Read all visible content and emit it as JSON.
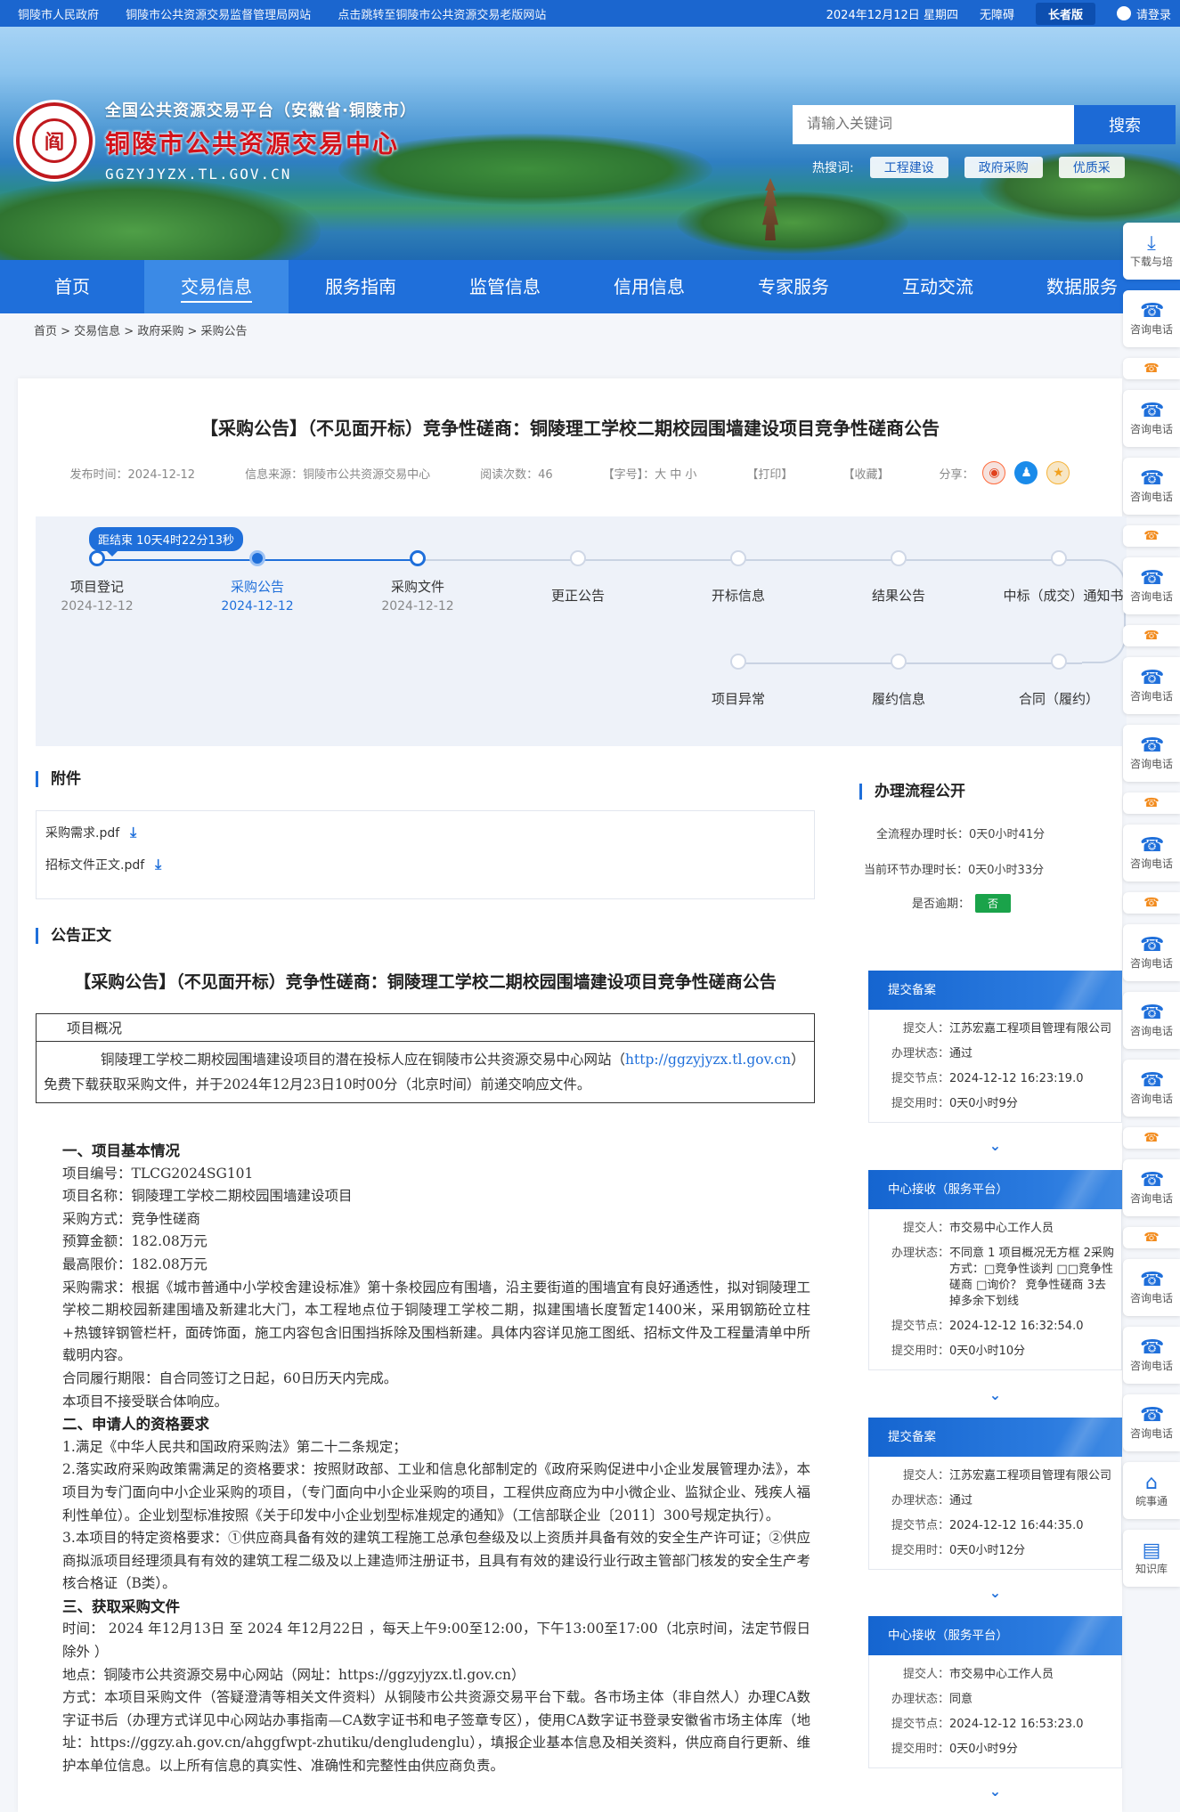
{
  "topbar": {
    "links": [
      "铜陵市人民政府",
      "铜陵市公共资源交易监督管理局网站",
      "点击跳转至铜陵市公共资源交易老版网站"
    ],
    "date": "2024年12月12日 星期四",
    "accessibility": "无障碍",
    "elder": "长者版",
    "login": "请登录"
  },
  "header": {
    "platform": "全国公共资源交易平台（安徽省·铜陵市）",
    "name": "铜陵市公共资源交易中心",
    "domain": "GGZYJYZX.TL.GOV.CN",
    "seal_char": "阎",
    "search_placeholder": "请输入关键词",
    "search_button": "搜索",
    "hot_label": "热搜词:",
    "hot_tags": [
      "工程建设",
      "政府采购",
      "优质采"
    ]
  },
  "nav": [
    "首页",
    "交易信息",
    "服务指南",
    "监管信息",
    "信用信息",
    "专家服务",
    "互动交流",
    "数据服务"
  ],
  "breadcrumb": "首页 > 交易信息 > 政府采购 > 采购公告",
  "side": {
    "first": "下载与培",
    "consult": "咨询电话",
    "wanshi": "皖事通",
    "knowledge": "知识库"
  },
  "article": {
    "title": "【采购公告】（不见面开标）竞争性磋商：铜陵理工学校二期校园围墙建设项目竞争性磋商公告",
    "publish": "发布时间：2024-12-12",
    "source": "信息来源：铜陵市公共资源交易中心",
    "reads": "阅读次数：46",
    "fontsize": "【字号】：大 中 小",
    "print": "【打印】",
    "fav": "【收藏】",
    "share": "分享："
  },
  "process": {
    "countdown": "距结束  10天4时22分13秒",
    "steps": [
      {
        "name": "项目登记",
        "date": "2024-12-12"
      },
      {
        "name": "采购公告",
        "date": "2024-12-12"
      },
      {
        "name": "采购文件",
        "date": "2024-12-12"
      },
      {
        "name": "更正公告",
        "date": ""
      },
      {
        "name": "开标信息",
        "date": ""
      },
      {
        "name": "结果公告",
        "date": ""
      },
      {
        "name": "中标（成交）通知书",
        "date": ""
      }
    ],
    "row2": [
      "项目异常",
      "履约信息",
      "合同（履约）"
    ]
  },
  "attachments": {
    "heading": "附件",
    "files": [
      "采购需求.pdf",
      "招标文件正文.pdf"
    ]
  },
  "notice": {
    "heading": "公告正文",
    "title": "【采购公告】（不见面开标）竞争性磋商：铜陵理工学校二期校园围墙建设项目竞争性磋商公告",
    "box_head": "项目概况",
    "box_text1": "铜陵理工学校二期校园围墙建设项目的潜在投标人应在铜陵市公共资源交易中心网站（",
    "box_link": "http://ggzyjyzx.tl.gov.cn",
    "box_text2": "）免费下载获取采购文件，并于2024年12月23日10时00分（北京时间）前递交响应文件。",
    "lines": [
      {
        "h": true,
        "t": "一、项目基本情况"
      },
      {
        "t": "项目编号：TLCG2024SG101"
      },
      {
        "t": "项目名称：铜陵理工学校二期校园围墙建设项目"
      },
      {
        "t": "采购方式：竞争性磋商"
      },
      {
        "t": "预算金额：182.08万元"
      },
      {
        "t": "最高限价：182.08万元"
      },
      {
        "j": true,
        "t": "采购需求：根据《城市普通中小学校舍建设标准》第十条校园应有围墙，沿主要街道的围墙宜有良好通透性，拟对铜陵理工学校二期校园新建围墙及新建北大门，本工程地点位于铜陵理工学校二期，拟建围墙长度暂定1400米，采用钢筋砼立柱+热镀锌钢管栏杆，面砖饰面，施工内容包含旧围挡拆除及围档新建。具体内容详见施工图纸、招标文件及工程量清单中所载明内容。"
      },
      {
        "t": "合同履行期限：自合同签订之日起，60日历天内完成。"
      },
      {
        "t": "本项目不接受联合体响应。"
      },
      {
        "h": true,
        "t": "二、申请人的资格要求"
      },
      {
        "t": "1.满足《中华人民共和国政府采购法》第二十二条规定；"
      },
      {
        "j": true,
        "t": "2.落实政府采购政策需满足的资格要求：按照财政部、工业和信息化部制定的《政府采购促进中小企业发展管理办法》，本项目为专门面向中小企业采购的项目，（专门面向中小企业采购的项目，工程供应商应为中小微企业、监狱企业、残疾人福利性单位）。企业划型标准按照《关于印发中小企业划型标准规定的通知》（工信部联企业〔2011〕300号规定执行）。"
      },
      {
        "j": true,
        "t": "3.本项目的特定资格要求：①供应商具备有效的建筑工程施工总承包叁级及以上资质并具备有效的安全生产许可证；②供应商拟派项目经理须具有有效的建筑工程二级及以上建造师注册证书，且具有有效的建设行业行政主管部门核发的安全生产考核合格证（B类）。"
      },
      {
        "h": true,
        "t": "三、获取采购文件"
      },
      {
        "j": true,
        "t": "时间： 2024 年12月13日 至 2024 年12月22日 ，每天上午9:00至12:00，下午13:00至17:00（北京时间，法定节假日除外 ）"
      },
      {
        "t": "地点：铜陵市公共资源交易中心网站（网址：https://ggzyjyzx.tl.gov.cn）"
      },
      {
        "j": true,
        "t": "方式：本项目采购文件（答疑澄清等相关文件资料）从铜陵市公共资源交易平台下载。各市场主体（非自然人）办理CA数字证书后（办理方式详见中心网站办事指南—CA数字证书和电子签章专区），使用CA数字证书登录安徽省市场主体库（地址：https://ggzy.ah.gov.cn/ahggfwpt-zhutiku/dengludenglu），填报企业基本信息及相关资料，供应商自行更新、维护本单位信息。以上所有信息的真实性、准确性和完整性由供应商负责。"
      }
    ]
  },
  "right": {
    "heading": "办理流程公开",
    "total": "全流程办理时长：0天0小时41分",
    "current": "当前环节办理时长：0天0小时33分",
    "overdue_label": "是否逾期：",
    "overdue_value": "否",
    "keys": {
      "submitter": "提交人：",
      "status": "办理状态：",
      "node": "提交节点：",
      "cost": "提交用时："
    },
    "flows": [
      {
        "title": "提交备案",
        "submitter": "江苏宏嘉工程项目管理有限公司",
        "status": "通过",
        "node": "2024-12-12 16:23:19.0",
        "cost": "0天0小时9分"
      },
      {
        "title": "中心接收（服务平台）",
        "submitter": "市交易中心工作人员",
        "status": "不同意 1 项目概况无方框 2采购方式：□竞争性谈判 □□竞争性磋商 □询价？ 竞争性磋商 3去掉多余下划线",
        "node": "2024-12-12 16:32:54.0",
        "cost": "0天0小时10分"
      },
      {
        "title": "提交备案",
        "submitter": "江苏宏嘉工程项目管理有限公司",
        "status": "通过",
        "node": "2024-12-12 16:44:35.0",
        "cost": "0天0小时12分"
      },
      {
        "title": "中心接收（服务平台）",
        "submitter": "市交易中心工作人员",
        "status": "同意",
        "node": "2024-12-12 16:53:23.0",
        "cost": "0天0小时9分"
      }
    ]
  },
  "colors": {
    "primary": "#1f6fda",
    "nav": "#1f6fda",
    "brand_red": "#d3121a",
    "ok_green": "#1aa34a"
  }
}
